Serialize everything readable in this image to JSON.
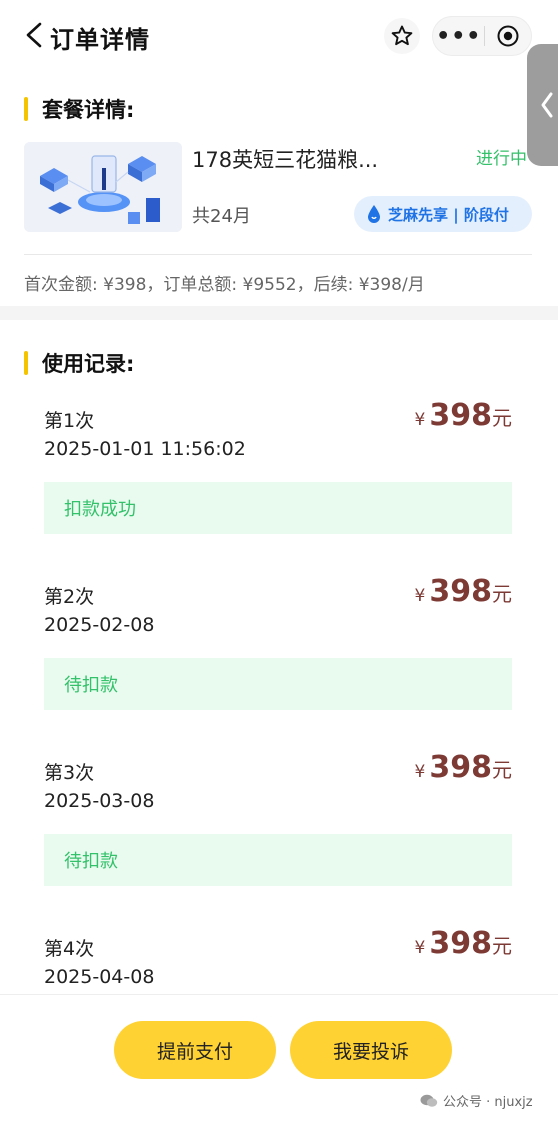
{
  "nav": {
    "title": "订单详情",
    "more_glyph": "•••"
  },
  "package": {
    "section_title": "套餐详情:",
    "name": "178英短三花猫粮...",
    "status": "进行中",
    "period": "共24月",
    "badge_label": "芝麻先享 | 阶段付",
    "amount_summary": "首次金额: ¥398，订单总额: ¥9552，后续: ¥398/月"
  },
  "records": {
    "section_title": "使用记录:",
    "currency": "¥",
    "unit": "元",
    "items": [
      {
        "no": "第1次",
        "date": "2025-01-01 11:56:02",
        "amount": "398",
        "status": "扣款成功"
      },
      {
        "no": "第2次",
        "date": "2025-02-08",
        "amount": "398",
        "status": "待扣款"
      },
      {
        "no": "第3次",
        "date": "2025-03-08",
        "amount": "398",
        "status": "待扣款"
      },
      {
        "no": "第4次",
        "date": "2025-04-08",
        "amount": "398",
        "status": ""
      }
    ]
  },
  "actions": {
    "prepay_label": "提前支付",
    "complain_label": "我要投诉"
  },
  "watermark": "公众号 · njuxjz",
  "colors": {
    "accent_yellow": "#ffd234",
    "section_bar": "#f5c400",
    "status_green": "#33c16a",
    "price": "#7d3a35",
    "zhima_blue": "#1f73e5"
  }
}
